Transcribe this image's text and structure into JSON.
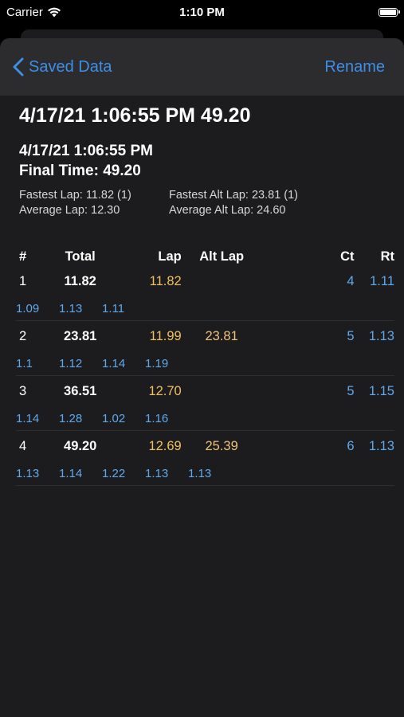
{
  "status_bar": {
    "carrier": "Carrier",
    "time": "1:10 PM",
    "battery_level": 1.0
  },
  "nav": {
    "back_label": "Saved Data",
    "action_label": "Rename"
  },
  "record": {
    "title": "4/17/21 1:06:55 PM 49.20",
    "datetime": "4/17/21  1:06:55 PM",
    "final_time": "Final Time: 49.20",
    "fastest_lap": "Fastest Lap: 11.82 (1)",
    "fastest_alt_lap": "Fastest Alt Lap: 23.81 (1)",
    "average_lap": "Average Lap: 12.30",
    "average_alt_lap": "Average Alt Lap: 24.60"
  },
  "table": {
    "headers": {
      "num": "#",
      "total": "Total",
      "lap": "Lap",
      "alt_lap": "Alt Lap",
      "ct": "Ct",
      "rt": "Rt"
    },
    "rows": [
      {
        "num": "1",
        "total": "11.82",
        "lap": "11.82",
        "alt_lap": "",
        "ct": "4",
        "rt": "1.11",
        "splits": [
          "1.09",
          "1.13",
          "1.11"
        ]
      },
      {
        "num": "2",
        "total": "23.81",
        "lap": "11.99",
        "alt_lap": "23.81",
        "ct": "5",
        "rt": "1.13",
        "splits": [
          "1.1",
          "1.12",
          "1.14",
          "1.19"
        ]
      },
      {
        "num": "3",
        "total": "36.51",
        "lap": "12.70",
        "alt_lap": "",
        "ct": "5",
        "rt": "1.15",
        "splits": [
          "1.14",
          "1.28",
          "1.02",
          "1.16"
        ]
      },
      {
        "num": "4",
        "total": "49.20",
        "lap": "12.69",
        "alt_lap": "25.39",
        "ct": "6",
        "rt": "1.13",
        "splits": [
          "1.13",
          "1.14",
          "1.22",
          "1.13",
          "1.13"
        ]
      }
    ]
  },
  "colors": {
    "accent": "#3d8ee6",
    "lap": "#f0c060",
    "split": "#5ea9ec"
  }
}
